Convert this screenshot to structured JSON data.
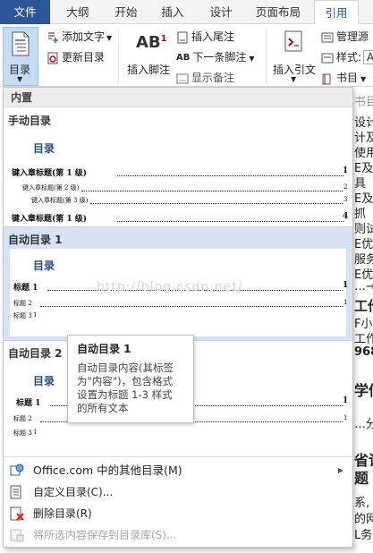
{
  "tabs": [
    {
      "label": "文件",
      "type": "file"
    },
    {
      "label": "大纲"
    },
    {
      "label": "开始"
    },
    {
      "label": "插入"
    },
    {
      "label": "设计"
    },
    {
      "label": "页面布局"
    },
    {
      "label": "引用",
      "active": true
    }
  ],
  "ribbon": {
    "toc_button": "目录",
    "add_text": "添加文字",
    "update_toc": "更新目录",
    "insert_footnote": "插入脚注",
    "insert_endnote": "插入尾注",
    "next_footnote": "下一条脚注",
    "show_notes": "显示备注",
    "insert_citation": "插入引文",
    "manage_sources": "管理源",
    "style": "样式:",
    "style_value": "A",
    "bibliography": "书目"
  },
  "document_fragments": [
    "书目",
    "设计",
    "计及",
    "使用",
    "E及",
    "具",
    "E及",
    "抓",
    "则试-",
    "E优",
    "服务",
    "E优",
    "…→",
    "工作",
    "F小",
    "工作",
    "968",
    "学信",
    "…分",
    "省论",
    "题",
    "系,",
    "的网",
    "L务"
  ],
  "dropdown": {
    "section_label": "内置",
    "items": [
      {
        "title": "手动目录",
        "heading": "目录",
        "lines": [
          {
            "text": "键入章标题(第 1 级)",
            "page": "1"
          },
          {
            "text": "键入章标题(第 2 级)",
            "page": "2"
          },
          {
            "text": "键入章标题(第 3 级)",
            "page": "3"
          },
          {
            "text": "键入章标题(第 1 级)",
            "page": "4"
          }
        ]
      },
      {
        "title": "自动目录 1",
        "heading": "目录",
        "lines": [
          {
            "text": "标题 1",
            "page": "1"
          },
          {
            "text": "标题 2",
            "page": "1"
          },
          {
            "text": "标题 3",
            "page": "1"
          }
        ]
      },
      {
        "title": "自动目录 2",
        "heading": "目录",
        "lines": [
          {
            "text": "标题 1",
            "page": "1"
          },
          {
            "text": "标题 2",
            "page": "1"
          },
          {
            "text": "标题 3",
            "page": "1"
          }
        ]
      }
    ],
    "menu": [
      {
        "label": "Office.com 中的其他目录(M)",
        "icon": "office-icon",
        "submenu": true
      },
      {
        "label": "自定义目录(C)...",
        "icon": "custom-toc-icon"
      },
      {
        "label": "删除目录(R)",
        "icon": "delete-toc-icon"
      },
      {
        "label": "将所选内容保存到目录库(S)...",
        "icon": "save-selection-icon",
        "disabled": true
      }
    ]
  },
  "tooltip": {
    "title": "自动目录 1",
    "body": "自动目录内容(其标签\n为\"内容\")，包含格式\n设置为标题 1-3 样式\n的所有文本"
  },
  "watermark": "http://blog.csdn.net/",
  "colors": {
    "accent": "#2b579a",
    "hover": "#d7e3f4",
    "selected": "#c5dcf5"
  }
}
